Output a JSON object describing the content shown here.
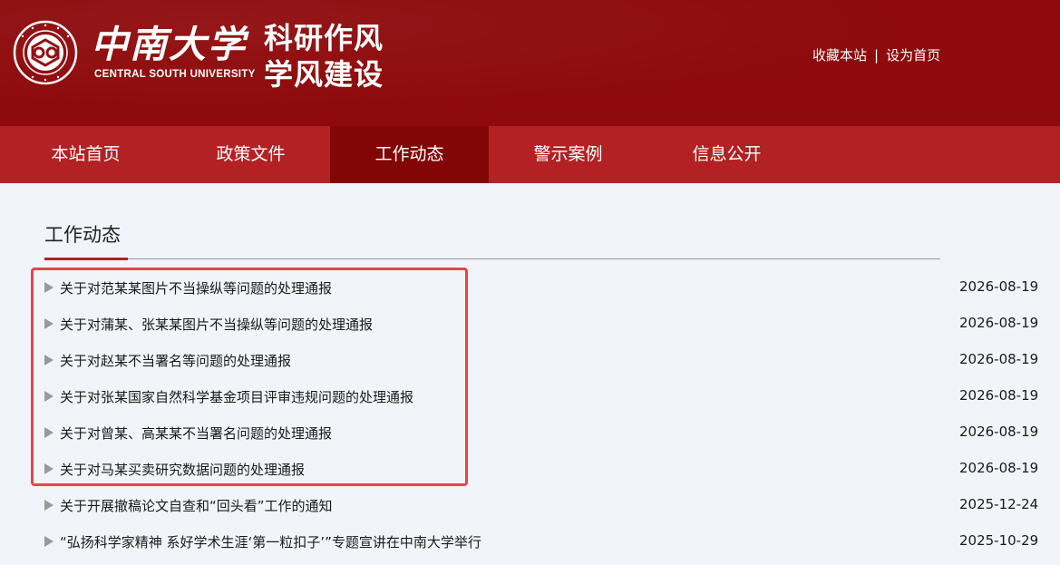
{
  "header": {
    "logo_cn": "中南大学",
    "logo_en": "CENTRAL SOUTH UNIVERSITY",
    "site_title_line1": "科研作风",
    "site_title_line2": "学风建设",
    "top_links": {
      "favorite": "收藏本站",
      "separator": "|",
      "homepage": "设为首页"
    }
  },
  "nav": {
    "items": [
      {
        "label": "本站首页"
      },
      {
        "label": "政策文件"
      },
      {
        "label": "工作动态",
        "active": true
      },
      {
        "label": "警示案例"
      },
      {
        "label": "信息公开"
      }
    ]
  },
  "main": {
    "section_title": "工作动态",
    "news": [
      {
        "title": "关于对范某某图片不当操纵等问题的处理通报",
        "date": "2026-08-19",
        "highlighted": true
      },
      {
        "title": "关于对蒲某、张某某图片不当操纵等问题的处理通报",
        "date": "2026-08-19",
        "highlighted": true
      },
      {
        "title": "关于对赵某不当署名等问题的处理通报",
        "date": "2026-08-19",
        "highlighted": true
      },
      {
        "title": "关于对张某国家自然科学基金项目评审违规问题的处理通报",
        "date": "2026-08-19",
        "highlighted": true
      },
      {
        "title": "关于对曾某、高某某不当署名问题的处理通报",
        "date": "2026-08-19",
        "highlighted": true
      },
      {
        "title": "关于对马某买卖研究数据问题的处理通报",
        "date": "2026-08-19",
        "highlighted": true
      },
      {
        "title": "关于开展撤稿论文自查和“回头看”工作的通知",
        "date": "2025-12-24",
        "highlighted": false
      },
      {
        "title": "“弘扬科学家精神 系好学术生涯‘第一粒扣子’”专题宣讲在中南大学举行",
        "date": "2025-10-29",
        "highlighted": false
      }
    ]
  },
  "colors": {
    "header_bg": "#8e0a0c",
    "nav_bg": "#b32124",
    "nav_active_bg": "#830607",
    "page_bg": "#f1f4f8",
    "highlight_border": "#e8454a"
  }
}
